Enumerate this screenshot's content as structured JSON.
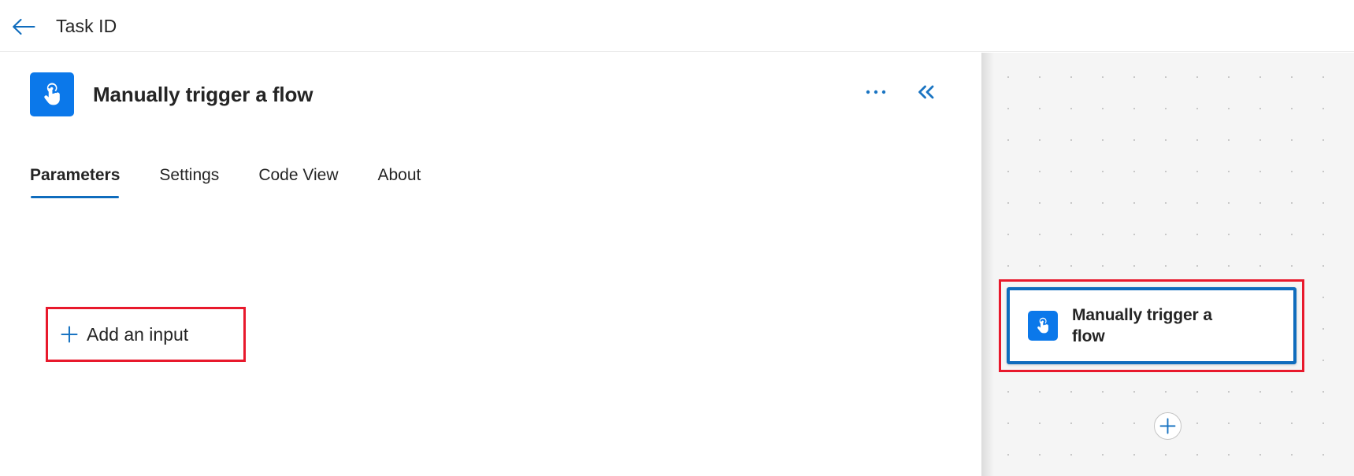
{
  "topbar": {
    "back_icon": "arrow-left-icon",
    "title": "Task ID"
  },
  "panel": {
    "icon": "manual-trigger-tap-icon",
    "title": "Manually trigger a flow",
    "actions": {
      "more_icon": "ellipsis-icon",
      "more_label": "…",
      "collapse_icon": "double-chevron-left-icon",
      "collapse_label": "«"
    },
    "tabs": [
      {
        "label": "Parameters",
        "active": true
      },
      {
        "label": "Settings",
        "active": false
      },
      {
        "label": "Code View",
        "active": false
      },
      {
        "label": "About",
        "active": false
      }
    ],
    "add_input": {
      "icon": "plus-icon",
      "label": "Add an input"
    }
  },
  "canvas": {
    "node": {
      "icon": "manual-trigger-tap-icon",
      "title": "Manually trigger a flow",
      "selected": true
    },
    "add_step": {
      "icon": "plus-icon"
    }
  },
  "colors": {
    "accent_blue": "#0f6cbd",
    "icon_blue": "#0b78ea",
    "annotation_red": "#e8192c",
    "text_primary": "#242424",
    "canvas_bg": "#f5f5f5"
  }
}
